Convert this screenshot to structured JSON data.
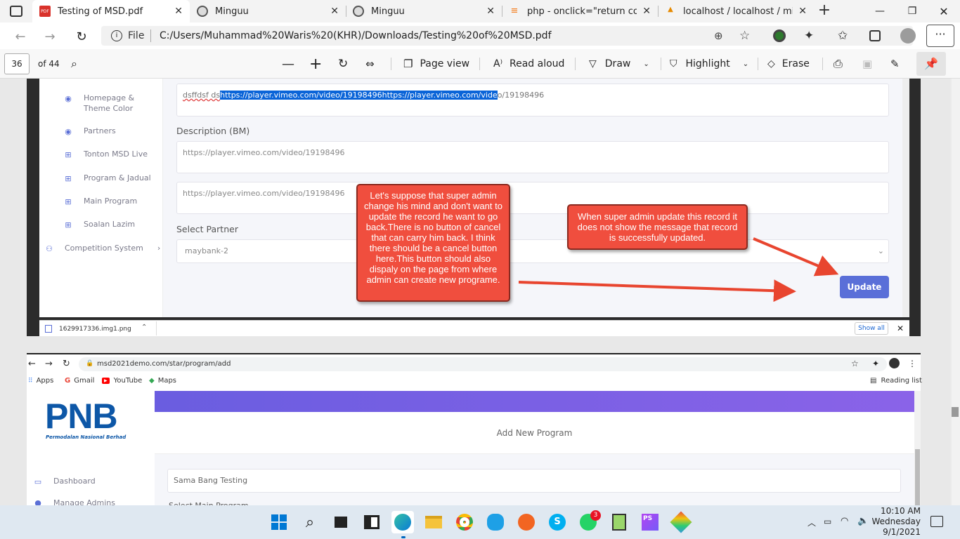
{
  "edge": {
    "tabs": [
      {
        "label": "Testing of MSD.pdf",
        "icon": "pdf-icon"
      },
      {
        "label": "Minguu",
        "icon": "avatar-icon"
      },
      {
        "label": "Minguu",
        "icon": "avatar-icon"
      },
      {
        "label": "php - onclick=\"return confirm",
        "icon": "stackoverflow-icon"
      },
      {
        "label": "localhost / localhost / mingu",
        "icon": "phpmyadmin-icon"
      }
    ],
    "url_label": "File",
    "url": "C:/Users/Muhammad%20Waris%20(KHR)/Downloads/Testing%20of%20MSD.pdf"
  },
  "pdf_toolbar": {
    "page": "36",
    "of": "of 44",
    "page_view": "Page view",
    "read_aloud": "Read aloud",
    "draw": "Draw",
    "highlight": "Highlight",
    "erase": "Erase"
  },
  "admin1": {
    "menu": [
      "Homepage &",
      "Theme Color",
      "Partners",
      "Tonton MSD Live",
      "Program & Jadual",
      "Main Program",
      "Soalan Lazim",
      "Competition System"
    ],
    "desc_text_prefix": "dsffdsf ds",
    "desc_text_selected": "https://player.vimeo.com/video/19198496https://player.vimeo.com/vide",
    "desc_text_suffix": "o/19198496",
    "label_desc_bm": "Description (BM)",
    "desc_bm_value": "https://player.vimeo.com/video/19198496",
    "desc_bm2_value": "https://player.vimeo.com/video/19198496",
    "label_partner": "Select Partner",
    "partner_value": "maybank-2",
    "update": "Update"
  },
  "notes": {
    "cancel": "Let's suppose that super admin change his mind and don't want to update the record he want to go back.There is no button of cancel that can carry him back. I think there should be a cancel button here.This button should also dispaly on the page from where admin can create new programe.",
    "success": "When super admin update this record it does not show the message that record is successfully updated."
  },
  "download": {
    "file": "1629917336.img1.png",
    "show_all": "Show all"
  },
  "chrome": {
    "url": "msd2021demo.com/star/program/add",
    "bookmarks": [
      "Apps",
      "Gmail",
      "YouTube",
      "Maps"
    ],
    "reading_list": "Reading list",
    "logo": "PNB",
    "logo_sub": "Permodalan Nasional Berhad",
    "page_title": "Add New Program",
    "menu": [
      "Dashboard",
      "Manage Admins"
    ],
    "program_value": "Sama Bang Testing",
    "partial_label": "Select Main Program"
  },
  "taskbar": {
    "time": "10:10 AM",
    "day": "Wednesday",
    "date": "9/1/2021",
    "whatsapp_badge": "3"
  },
  "colors": {
    "accent": "#5a6fd8",
    "note": "#f04e3e",
    "gradient_from": "#6a5de0",
    "gradient_to": "#8a63e8"
  }
}
